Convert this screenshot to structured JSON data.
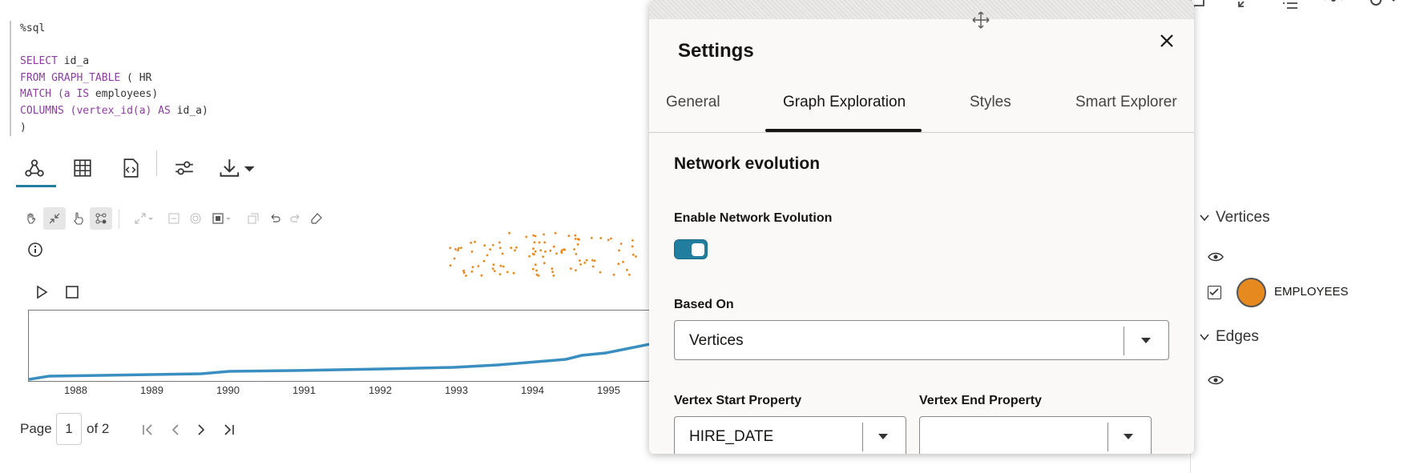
{
  "code": {
    "lines": [
      [
        {
          "t": "%sql",
          "kw": false
        }
      ],
      [],
      [
        {
          "t": "SELECT",
          "kw": true
        },
        {
          "t": " id_a",
          "kw": false
        }
      ],
      [
        {
          "t": "FROM",
          "kw": true
        },
        {
          "t": " ",
          "kw": false
        },
        {
          "t": "GRAPH_TABLE",
          "kw": true
        },
        {
          "t": " ( HR",
          "kw": false
        }
      ],
      [
        {
          "t": "MATCH",
          "kw": true
        },
        {
          "t": " ",
          "kw": false
        },
        {
          "t": "(a",
          "kw": true
        },
        {
          "t": " ",
          "kw": false
        },
        {
          "t": "IS",
          "kw": true
        },
        {
          "t": " employees)",
          "kw": false
        }
      ],
      [
        {
          "t": "COLUMNS",
          "kw": true
        },
        {
          "t": " ",
          "kw": false
        },
        {
          "t": "(vertex_id(a)",
          "kw": true
        },
        {
          "t": " ",
          "kw": false
        },
        {
          "t": "AS",
          "kw": true
        },
        {
          "t": " id_a)",
          "kw": false
        }
      ],
      [
        {
          "t": ")",
          "kw": false
        }
      ]
    ]
  },
  "result_tabs": [
    "graph-icon",
    "table-icon",
    "code-file-icon",
    "sliders-icon",
    "download-icon"
  ],
  "timeline": {
    "years": [
      "1988",
      "1989",
      "1990",
      "1991",
      "1992",
      "1993",
      "1994",
      "1995"
    ],
    "series_color": "#3a8fc0"
  },
  "pagination": {
    "page_label": "Page",
    "current": "1",
    "of_label": "of 2"
  },
  "legend": {
    "vertices_label": "Vertices",
    "edges_label": "Edges",
    "employees_label": "EMPLOYEES",
    "employee_color": "#e6891e"
  },
  "settings": {
    "title": "Settings",
    "tabs": [
      "General",
      "Graph Exploration",
      "Styles",
      "Smart Explorer"
    ],
    "selected_tab": "Graph Exploration",
    "section_title": "Network evolution",
    "enable_label": "Enable Network Evolution",
    "enable_value": true,
    "based_on_label": "Based On",
    "based_on_value": "Vertices",
    "vertex_start_label": "Vertex Start Property",
    "vertex_start_value": "HIRE_DATE",
    "vertex_end_label": "Vertex End Property",
    "vertex_end_value": "",
    "accent": "#227e9e"
  }
}
